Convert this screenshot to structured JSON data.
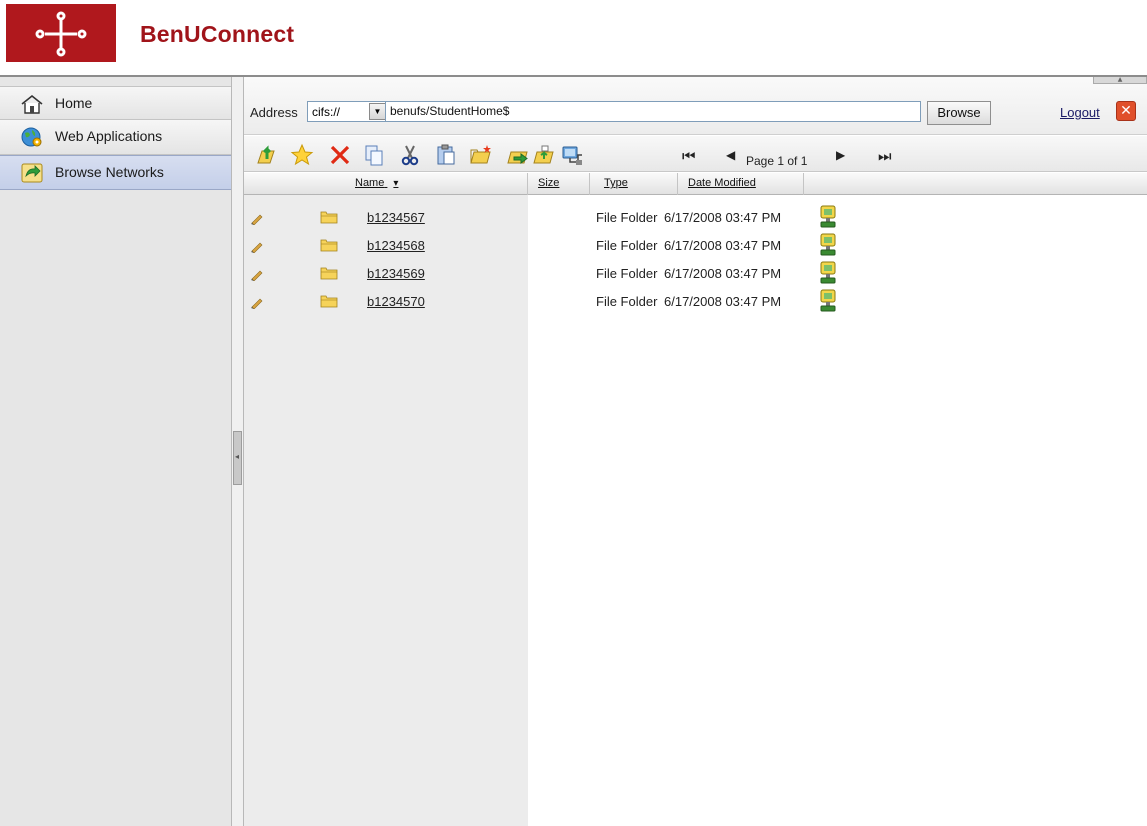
{
  "app": {
    "title": "BenUConnect"
  },
  "sidebar": {
    "items": [
      {
        "label": "Home",
        "icon": "home-icon",
        "selected": false
      },
      {
        "label": "Web Applications",
        "icon": "web-applications-icon",
        "selected": false
      },
      {
        "label": "Browse Networks",
        "icon": "browse-networks-icon",
        "selected": true
      }
    ]
  },
  "address": {
    "label": "Address",
    "protocol": "cifs://",
    "path": "benufs/StudentHome$",
    "browse_label": "Browse",
    "logout_label": "Logout"
  },
  "toolbar": {
    "icons": [
      "up-folder-icon",
      "favorite-star-icon",
      "delete-icon",
      "copy-icon",
      "cut-icon",
      "paste-icon",
      "new-folder-icon",
      "upload-icon",
      "open-folder-icon",
      "network-drive-icon",
      "first-page-icon",
      "previous-page-icon",
      "next-page-icon",
      "last-page-icon"
    ],
    "pager_text": "Page 1 of 1"
  },
  "grid": {
    "columns": [
      "Name",
      "Size",
      "Type",
      "Date Modified"
    ],
    "sort_indicator": "▾",
    "rows": [
      {
        "name": "b1234567",
        "type": "File Folder",
        "date": "6/17/2008 03:47 PM"
      },
      {
        "name": "b1234568",
        "type": "File Folder",
        "date": "6/17/2008 03:47 PM"
      },
      {
        "name": "b1234569",
        "type": "File Folder",
        "date": "6/17/2008 03:47 PM"
      },
      {
        "name": "b1234570",
        "type": "File Folder",
        "date": "6/17/2008 03:47 PM"
      }
    ]
  },
  "colors": {
    "brand": "#a0141a",
    "logo_bg": "#b0181d",
    "selected_nav": "#c9d3ec"
  }
}
